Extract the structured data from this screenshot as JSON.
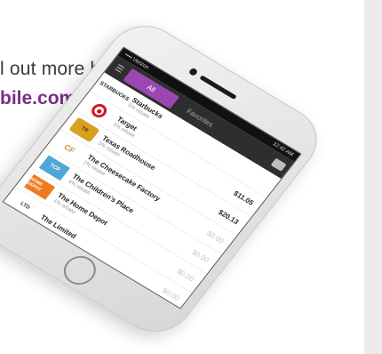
{
  "promo": {
    "line1": "l out more by",
    "line2": "bile.com"
  },
  "phone": {
    "status": {
      "carrier": "•••• Verizon",
      "time": "12:42 AM"
    },
    "tabs": {
      "all": "All",
      "favorites": "Favorites"
    },
    "merchants": [
      {
        "name": "Starbucks",
        "cashback": "5% rebate",
        "amount": "",
        "logo_text": "STARBUCKS"
      },
      {
        "name": "Target",
        "cashback": "3% rebate",
        "amount": "$11.05",
        "logo_text": "TARGET"
      },
      {
        "name": "Texas Roadhouse",
        "cashback": "5% rebate",
        "amount": "$20.13",
        "logo_text": "TR"
      },
      {
        "name": "The Cheesecake Factory",
        "cashback": "2% rebate",
        "amount": "$0.00",
        "logo_text": "CF"
      },
      {
        "name": "The Children's Place",
        "cashback": "4% rebate",
        "amount": "$0.00",
        "logo_text": "TCP"
      },
      {
        "name": "The Home Depot",
        "cashback": "1% rebate",
        "amount": "$0.00",
        "logo_text": "HOME DEPOT"
      },
      {
        "name": "The Limited",
        "cashback": "",
        "amount": "$0.00",
        "logo_text": "LTD"
      }
    ]
  },
  "colors": {
    "accent": "#9c46b4",
    "promo_link": "#7b2f86",
    "target_red": "#cc1a27"
  }
}
